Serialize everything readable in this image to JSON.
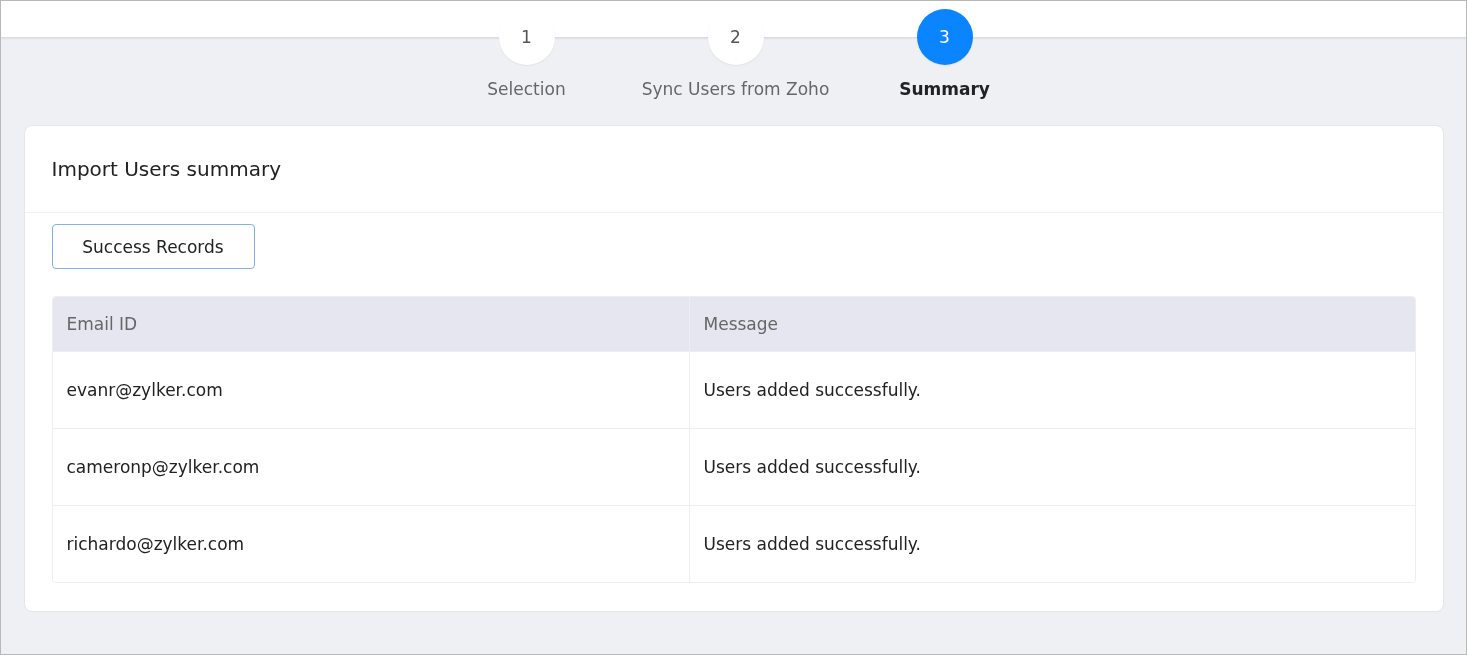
{
  "steps": [
    {
      "number": "1",
      "label": "Selection",
      "selected": false
    },
    {
      "number": "2",
      "label": "Sync Users from Zoho",
      "selected": false
    },
    {
      "number": "3",
      "label": "Summary",
      "selected": true
    }
  ],
  "card": {
    "title": "Import Users summary",
    "tab_button": "Success Records",
    "table": {
      "columns": [
        "Email ID",
        "Message"
      ],
      "rows": [
        [
          "evanr@zylker.com",
          "Users added successfully."
        ],
        [
          "cameronp@zylker.com",
          "Users added successfully."
        ],
        [
          "richardo@zylker.com",
          "Users added successfully."
        ]
      ]
    }
  }
}
